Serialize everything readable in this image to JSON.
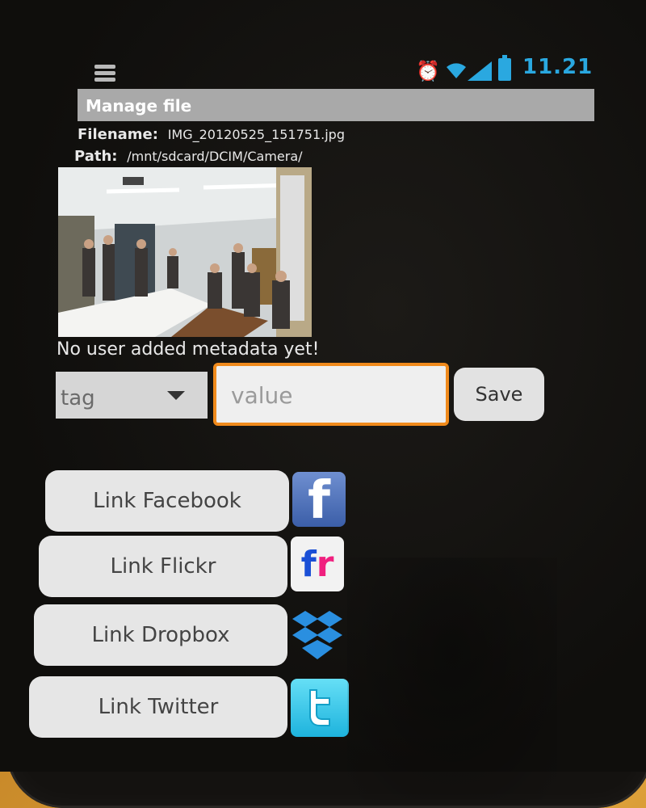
{
  "status_bar": {
    "time": "11.21",
    "icons": [
      "app-notification-icon",
      "alarm-icon",
      "wifi-icon",
      "signal-icon",
      "battery-icon"
    ],
    "accent_color": "#2aa8e0"
  },
  "header": {
    "title": "Manage file"
  },
  "file": {
    "filename_label": "Filename:",
    "filename": "IMG_20120525_151751.jpg",
    "path_label": "Path:",
    "path": "/mnt/sdcard/DCIM/Camera/"
  },
  "metadata": {
    "empty_message": "No user added metadata yet!",
    "tag_select_value": "tag",
    "value_placeholder": "value",
    "save_label": "Save",
    "focus_color": "#f08a1c"
  },
  "services": [
    {
      "label": "Link Facebook",
      "icon": "facebook-icon",
      "icon_text": "f"
    },
    {
      "label": "Link Flickr",
      "icon": "flickr-icon",
      "icon_text_1": "f",
      "icon_text_2": "r"
    },
    {
      "label": "Link Dropbox",
      "icon": "dropbox-icon"
    },
    {
      "label": "Link Twitter",
      "icon": "twitter-icon"
    }
  ]
}
